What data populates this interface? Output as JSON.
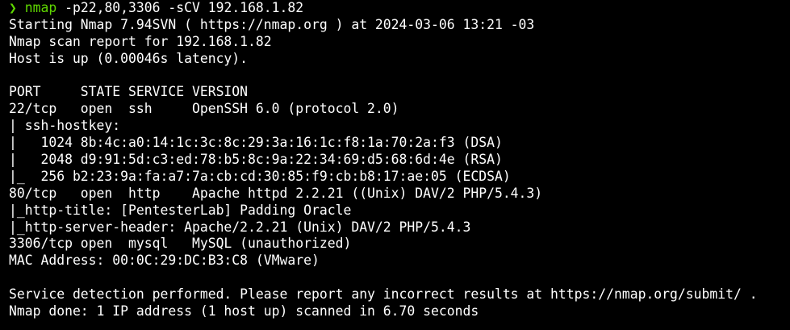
{
  "prompt": {
    "symbol": "❯",
    "command": "nmap",
    "args": " -p22,80,3306 -sCV 192.168.1.82"
  },
  "colors": {
    "background": "#000000",
    "text": "#ffffff",
    "command_green": "#5fd700"
  },
  "output": [
    "Starting Nmap 7.94SVN ( https://nmap.org ) at 2024-03-06 13:21 -03",
    "Nmap scan report for 192.168.1.82",
    "Host is up (0.00046s latency).",
    "",
    "PORT     STATE SERVICE VERSION",
    "22/tcp   open  ssh     OpenSSH 6.0 (protocol 2.0)",
    "| ssh-hostkey: ",
    "|   1024 8b:4c:a0:14:1c:3c:8c:29:3a:16:1c:f8:1a:70:2a:f3 (DSA)",
    "|   2048 d9:91:5d:c3:ed:78:b5:8c:9a:22:34:69:d5:68:6d:4e (RSA)",
    "|_  256 b2:23:9a:fa:a7:7a:cb:cd:30:85:f9:cb:b8:17:ae:05 (ECDSA)",
    "80/tcp   open  http    Apache httpd 2.2.21 ((Unix) DAV/2 PHP/5.4.3)",
    "|_http-title: [PentesterLab] Padding Oracle",
    "|_http-server-header: Apache/2.2.21 (Unix) DAV/2 PHP/5.4.3",
    "3306/tcp open  mysql   MySQL (unauthorized)",
    "MAC Address: 00:0C:29:DC:B3:C8 (VMware)",
    "",
    "Service detection performed. Please report any incorrect results at https://nmap.org/submit/ .",
    "Nmap done: 1 IP address (1 host up) scanned in 6.70 seconds"
  ]
}
